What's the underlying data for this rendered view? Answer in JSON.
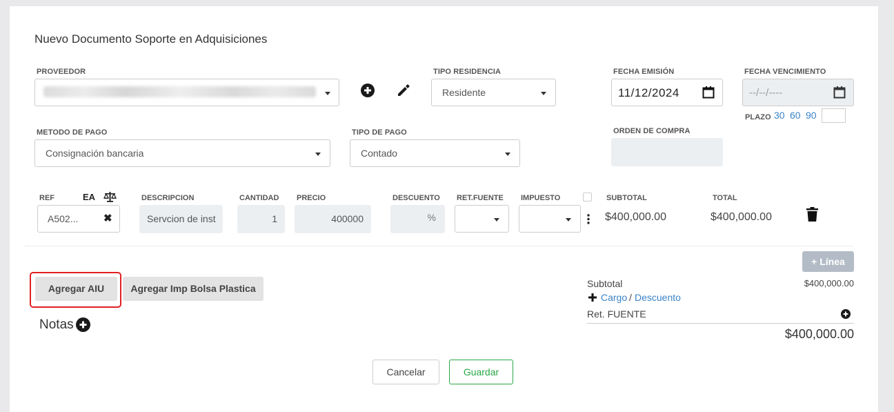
{
  "title": "Nuevo Documento Soporte en Adquisiciones",
  "proveedor": {
    "label": "PROVEEDOR"
  },
  "tipo_residencia": {
    "label": "TIPO RESIDENCIA",
    "value": "Residente"
  },
  "fecha_emision": {
    "label": "FECHA EMISIÓN",
    "value": "11/12/2024"
  },
  "fecha_vencimiento": {
    "label": "FECHA VENCIMIENTO",
    "placeholder": "--/--/----"
  },
  "plazo": {
    "label": "PLAZO",
    "options": [
      "30",
      "60",
      "90"
    ]
  },
  "metodo_pago": {
    "label": "METODO DE PAGO",
    "value": "Consignación bancaria"
  },
  "tipo_pago": {
    "label": "TIPO DE PAGO",
    "value": "Contado"
  },
  "orden_compra": {
    "label": "ORDEN DE COMPRA"
  },
  "line_headers": {
    "ref": "REF",
    "ea": "EA",
    "descripcion": "DESCRIPCION",
    "cantidad": "CANTIDAD",
    "precio": "PRECIO",
    "descuento": "DESCUENTO",
    "ret_fuente": "RET.FUENTE",
    "impuesto": "IMPUESTO",
    "subtotal": "SUBTOTAL",
    "total": "TOTAL"
  },
  "line": {
    "ref": "A502...",
    "descripcion": "Servcion de inst",
    "cantidad": "1",
    "precio": "400000",
    "descuento_unit": "%",
    "subtotal": "$400,000.00",
    "total": "$400,000.00"
  },
  "add_line_label": "+ Línea",
  "buttons": {
    "aiu": "Agregar AIU",
    "bolsa": "Agregar Imp Bolsa Plastica",
    "cancel": "Cancelar",
    "save": "Guardar"
  },
  "notas_label": "Notas",
  "summary": {
    "subtotal_label": "Subtotal",
    "subtotal_value": "$400,000.00",
    "cargo": "Cargo",
    "sep": "/",
    "descuento": "Descuento",
    "ret_fuente": "Ret. FUENTE",
    "total": "$400,000.00"
  },
  "colors": {
    "link": "#3a84c9",
    "save_green": "#28a745",
    "highlight": "#e02020"
  }
}
